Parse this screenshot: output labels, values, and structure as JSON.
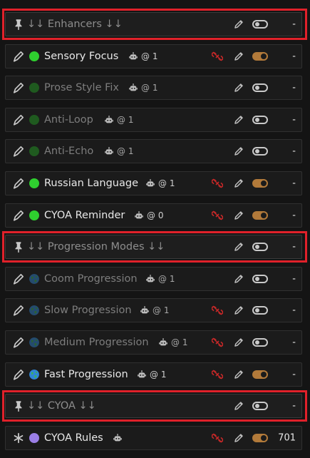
{
  "rows": [
    {
      "type": "header",
      "name": "↓↓ Enhancers ↓↓",
      "value": "-"
    },
    {
      "type": "entry",
      "enabled": true,
      "dot": "#2fcf2f",
      "name": "Sensory Focus",
      "at": "@ 1",
      "unlink": true,
      "value": "-"
    },
    {
      "type": "entry",
      "enabled": false,
      "dot": "#1f5a1f",
      "name": "Prose Style Fix",
      "at": "@ 1",
      "unlink": false,
      "value": "-"
    },
    {
      "type": "entry",
      "enabled": false,
      "dot": "#1f5a1f",
      "name": "Anti-Loop",
      "at": "@ 1",
      "unlink": false,
      "value": "-"
    },
    {
      "type": "entry",
      "enabled": false,
      "dot": "#1f5a1f",
      "name": "Anti-Echo",
      "at": "@ 1",
      "unlink": false,
      "value": "-"
    },
    {
      "type": "entry",
      "enabled": true,
      "dot": "#2fcf2f",
      "name": "Russian Language",
      "at": "@ 1",
      "unlink": true,
      "value": "-"
    },
    {
      "type": "entry",
      "enabled": true,
      "dot": "#2fcf2f",
      "name": "CYOA Reminder",
      "at": "@ 0",
      "unlink": true,
      "value": "-"
    },
    {
      "type": "header",
      "name": "↓↓ Progression Modes ↓↓",
      "value": "-"
    },
    {
      "type": "entry",
      "enabled": false,
      "dot": "globe-dim",
      "name": "Coom Progression",
      "at": "@ 1",
      "unlink": false,
      "value": "-"
    },
    {
      "type": "entry",
      "enabled": false,
      "dot": "globe-dim",
      "name": "Slow Progression",
      "at": "@ 1",
      "unlink": true,
      "value": "-"
    },
    {
      "type": "entry",
      "enabled": false,
      "dot": "globe-dim",
      "name": "Medium Progression",
      "at": "@ 1",
      "unlink": true,
      "value": "-"
    },
    {
      "type": "entry",
      "enabled": true,
      "dot": "globe",
      "name": "Fast Progression",
      "at": "@ 1",
      "unlink": true,
      "value": "-"
    },
    {
      "type": "header",
      "name": "↓↓ CYOA ↓↓",
      "value": "-"
    },
    {
      "type": "entry",
      "enabled": true,
      "dot": "#9b7fe6",
      "name": "CYOA Rules",
      "at": "",
      "unlink": true,
      "handle": "asterisk",
      "value": "701"
    }
  ],
  "highlight_color": "#e0212a",
  "accent_on": "#b27a3a"
}
